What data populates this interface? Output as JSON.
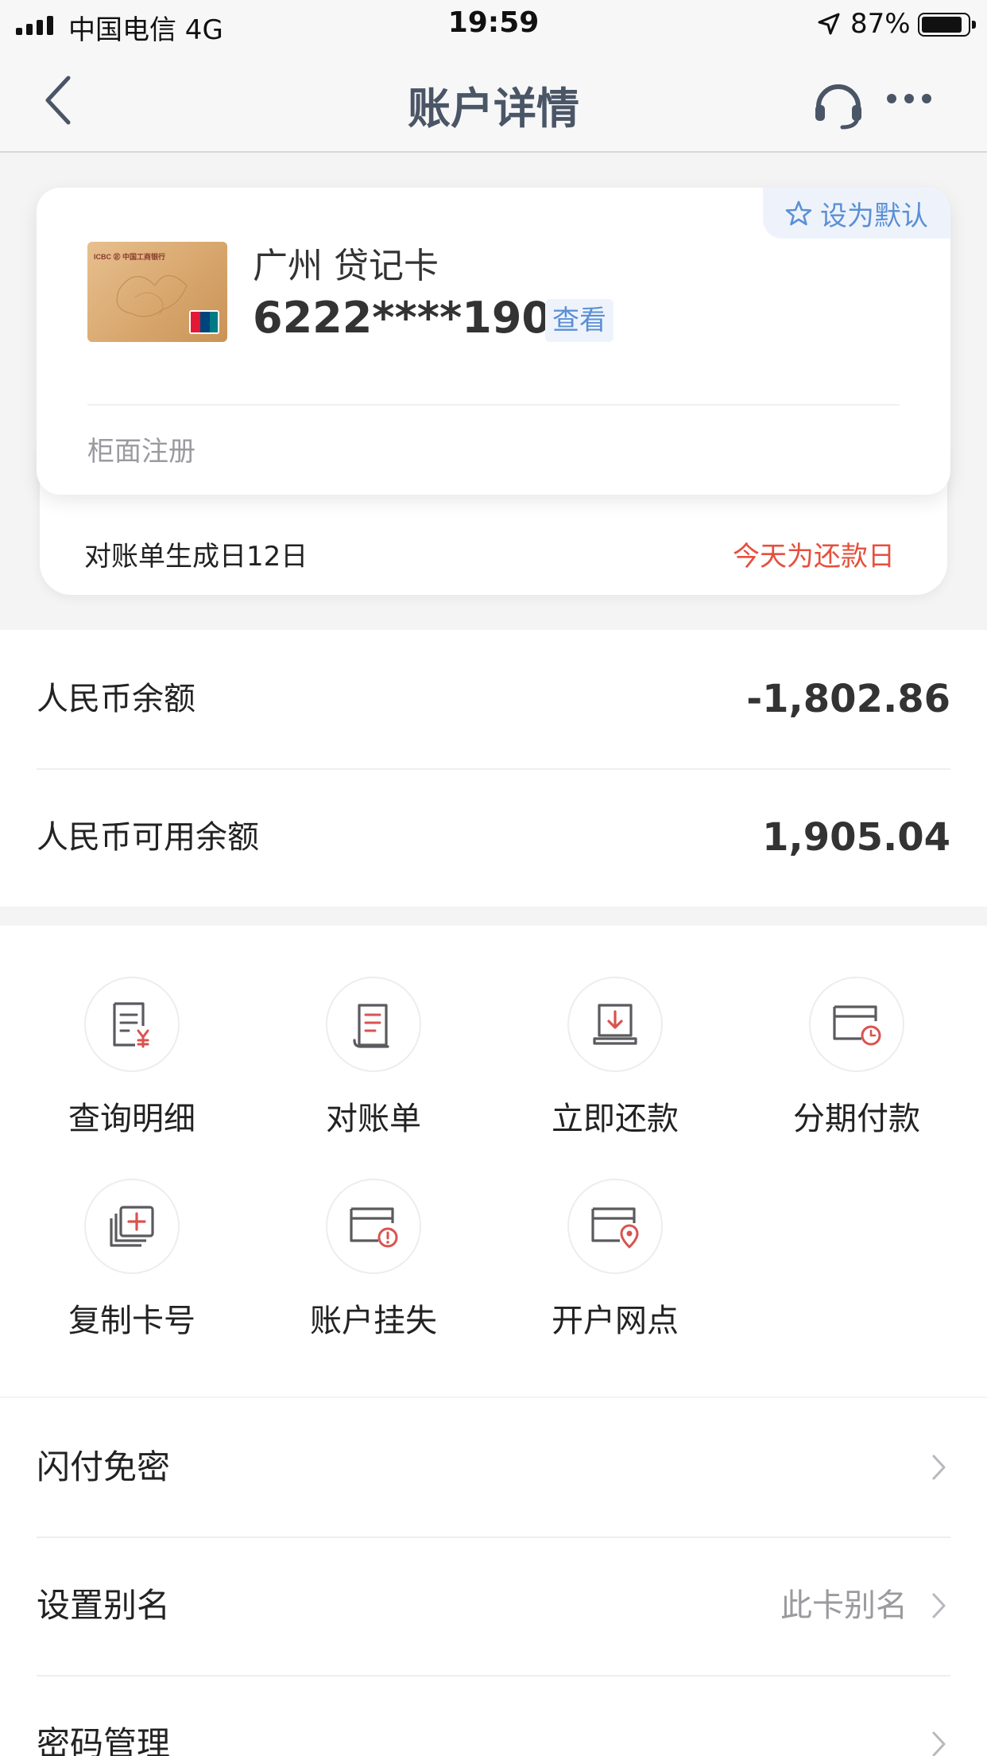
{
  "status_bar": {
    "carrier": "中国电信   4G",
    "time": "19:59",
    "battery": "87%"
  },
  "nav": {
    "title": "账户详情",
    "icons": [
      "back-chevron-icon",
      "headset-icon",
      "more-icon"
    ]
  },
  "card": {
    "default_label": "设为默认",
    "name": "广州 贷记卡",
    "number": "6222****1905",
    "view_label": "查看",
    "registration": "柜面注册",
    "statement_date": "对账单生成日12日",
    "due_notice": "今天为还款日",
    "bank_logo_text": "ICBC 中国工商银行"
  },
  "balances": [
    {
      "label": "人民币余额",
      "value": "-1,802.86"
    },
    {
      "label": "人民币可用余额",
      "value": "1,905.04"
    }
  ],
  "functions": [
    {
      "label": "查询明细",
      "icon": "detail-query-icon"
    },
    {
      "label": "对账单",
      "icon": "statement-icon"
    },
    {
      "label": "立即还款",
      "icon": "repay-icon"
    },
    {
      "label": "分期付款",
      "icon": "installment-icon"
    },
    {
      "label": "复制卡号",
      "icon": "copy-card-icon"
    },
    {
      "label": "账户挂失",
      "icon": "report-loss-icon"
    },
    {
      "label": "开户网点",
      "icon": "branch-location-icon"
    }
  ],
  "list": [
    {
      "label": "闪付免密",
      "hint": ""
    },
    {
      "label": "设置别名",
      "hint": "此卡别名"
    },
    {
      "label": "密码管理",
      "hint": ""
    }
  ],
  "colors": {
    "accent_blue": "#5b8fd6",
    "alert_red": "#e5503d",
    "icon_red": "#d9534f",
    "title_gray": "#4a5566"
  }
}
